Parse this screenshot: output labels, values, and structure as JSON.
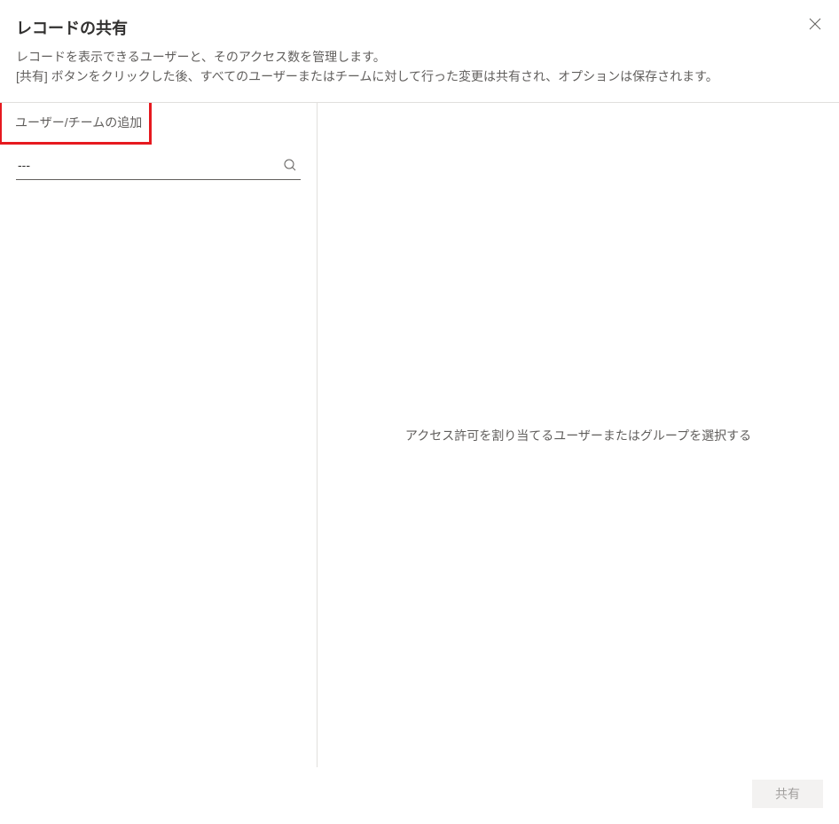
{
  "header": {
    "title": "レコードの共有"
  },
  "description": {
    "line1": "レコードを表示できるユーザーと、そのアクセス数を管理します。",
    "line2": "[共有] ボタンをクリックした後、すべてのユーザーまたはチームに対して行った変更は共有され、オプションは保存されます。"
  },
  "left": {
    "add_label": "ユーザー/チームの追加",
    "search_value": "---"
  },
  "right": {
    "placeholder": "アクセス許可を割り当てるユーザーまたはグループを選択する"
  },
  "footer": {
    "share_label": "共有"
  }
}
